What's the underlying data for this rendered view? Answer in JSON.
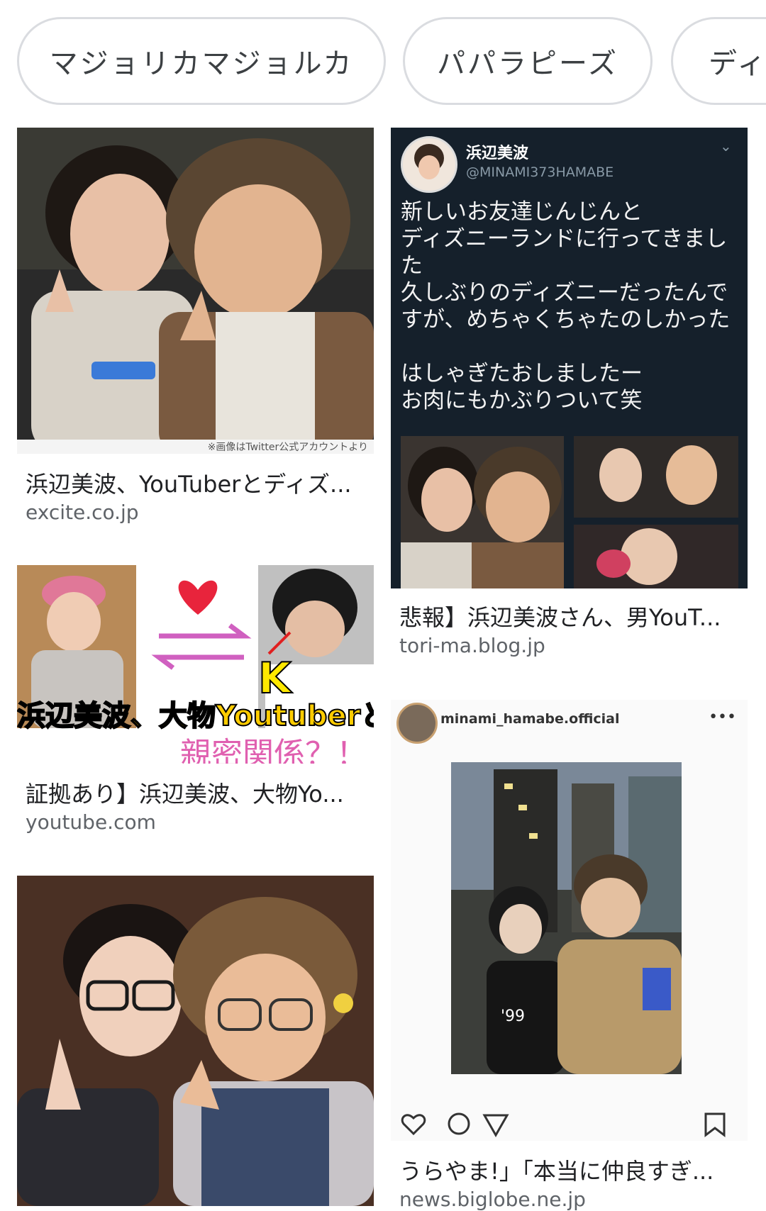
{
  "chips": [
    "マジョリカマジョルカ",
    "パパラピーズ",
    "ディ"
  ],
  "results": [
    {
      "title": "浜辺美波、YouTuberとディズ...",
      "source": "excite.co.jp",
      "image_watermark": "※画像はTwitter公式アカウントより"
    },
    {
      "title": "悲報】浜辺美波さん、男YouT...",
      "source": "tori-ma.blog.jp",
      "tweet": {
        "name": "浜辺美波",
        "handle": "@MINAMI373HAMABE",
        "text": "新しいお友達じんじんと\nディズニーランドに行ってきまし\nた\n久しぶりのディズニーだったんで\nすが、めちゃくちゃたのしかった\n\nはしゃぎたおしましたー\nお肉にもかぶりついて笑"
      }
    },
    {
      "title": "証拠あり】浜辺美波、大物Yo...",
      "source": "youtube.com",
      "image_caption_1": "浜辺美波、大物Youtuberと",
      "image_caption_2": "親密関係？！",
      "image_letter": "K"
    },
    {
      "title": "うらやま!」「本当に仲良すぎ...",
      "source": "news.biglobe.ne.jp",
      "insta": {
        "username": "minami_hamabe.official",
        "shirt_text": "'99"
      }
    },
    {
      "title": "",
      "source": ""
    }
  ],
  "colors": {
    "chip_border": "#dadce0",
    "title": "#202124",
    "source": "#5f6368",
    "tweet_bg": "#15202b"
  }
}
